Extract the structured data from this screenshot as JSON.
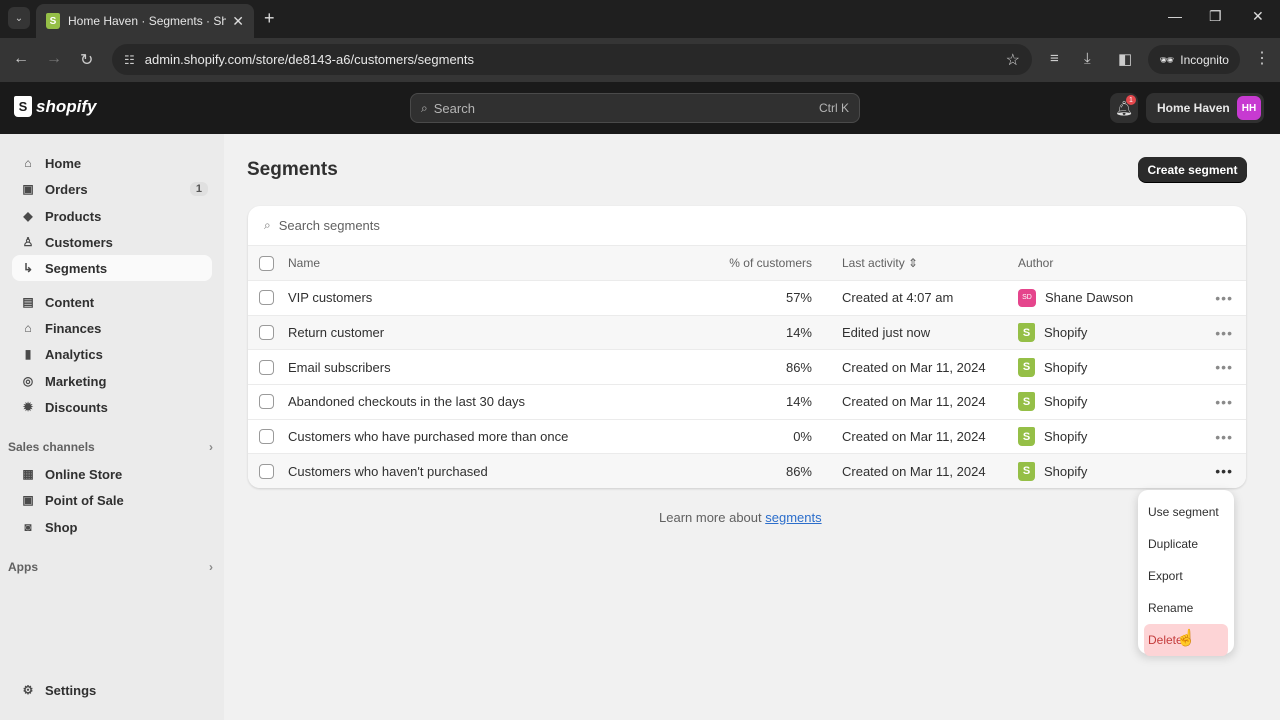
{
  "browser": {
    "tab_title": "Home Haven · Segments · Shop",
    "url": "admin.shopify.com/store/de8143-a6/customers/segments",
    "incognito_label": "Incognito"
  },
  "topbar": {
    "logo_text": "shopify",
    "search_placeholder": "Search",
    "search_shortcut": "Ctrl K",
    "notification_count": "1",
    "store_name": "Home Haven",
    "avatar_initials": "HH"
  },
  "sidebar": {
    "items": [
      {
        "label": "Home",
        "icon": "home-icon",
        "glyph": "⌂"
      },
      {
        "label": "Orders",
        "icon": "inbox-icon",
        "glyph": "▣",
        "badge": "1"
      },
      {
        "label": "Products",
        "icon": "tag-icon",
        "glyph": "◆"
      },
      {
        "label": "Customers",
        "icon": "person-icon",
        "glyph": "♙"
      },
      {
        "label": "Segments",
        "icon": "sub-arrow-icon",
        "glyph": "↳"
      },
      {
        "label": "Content",
        "icon": "content-icon",
        "glyph": "▤"
      },
      {
        "label": "Finances",
        "icon": "bank-icon",
        "glyph": "⌂"
      },
      {
        "label": "Analytics",
        "icon": "bar-chart-icon",
        "glyph": "▮"
      },
      {
        "label": "Marketing",
        "icon": "target-icon",
        "glyph": "◎"
      },
      {
        "label": "Discounts",
        "icon": "discount-icon",
        "glyph": "✹"
      }
    ],
    "sales_channels_label": "Sales channels",
    "channels": [
      {
        "label": "Online Store",
        "icon": "store-icon",
        "glyph": "▦"
      },
      {
        "label": "Point of Sale",
        "icon": "pos-icon",
        "glyph": "▣"
      },
      {
        "label": "Shop",
        "icon": "shop-icon",
        "glyph": "◙"
      }
    ],
    "apps_label": "Apps",
    "settings_label": "Settings"
  },
  "main": {
    "title": "Segments",
    "create_button": "Create segment",
    "search_placeholder": "Search segments",
    "columns": {
      "name": "Name",
      "pct": "% of customers",
      "activity": "Last activity",
      "author": "Author"
    },
    "rows": [
      {
        "name": "VIP customers",
        "pct": "57%",
        "activity": "Created at 4:07 am",
        "author": "Shane Dawson",
        "author_initials": "SD",
        "author_type": "user"
      },
      {
        "name": "Return customer",
        "pct": "14%",
        "activity": "Edited just now",
        "author": "Shopify",
        "author_type": "shopify"
      },
      {
        "name": "Email subscribers",
        "pct": "86%",
        "activity": "Created on Mar 11, 2024",
        "author": "Shopify",
        "author_type": "shopify"
      },
      {
        "name": "Abandoned checkouts in the last 30 days",
        "pct": "14%",
        "activity": "Created on Mar 11, 2024",
        "author": "Shopify",
        "author_type": "shopify"
      },
      {
        "name": "Customers who have purchased more than once",
        "pct": "0%",
        "activity": "Created on Mar 11, 2024",
        "author": "Shopify",
        "author_type": "shopify"
      },
      {
        "name": "Customers who haven't purchased",
        "pct": "86%",
        "activity": "Created on Mar 11, 2024",
        "author": "Shopify",
        "author_type": "shopify"
      }
    ],
    "learn_prefix": "Learn more about ",
    "learn_link": "segments"
  },
  "context_menu": [
    "Use segment",
    "Duplicate",
    "Export",
    "Rename",
    "Delete"
  ]
}
